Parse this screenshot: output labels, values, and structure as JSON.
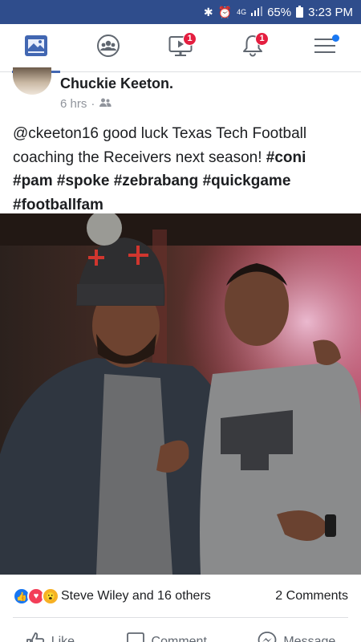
{
  "status_bar": {
    "battery": "65%",
    "time": "3:23 PM",
    "signal_label": "4G"
  },
  "nav": {
    "watch_badge": "1",
    "notifications_badge": "1"
  },
  "post": {
    "author": "Chuckie Keeton.",
    "time": "6 hrs",
    "text_plain": "@ckeeton16 good luck Texas Tech Football coaching the  Receivers next season! ",
    "tags": [
      "#coni",
      "#pam",
      "#spoke",
      "#zebrabang",
      "#quickgame",
      "#footballfam"
    ],
    "reactions_text": "Steve Wiley and 16 others",
    "comments_text": "2 Comments"
  },
  "actions": {
    "like": "Like",
    "comment": "Comment",
    "message": "Message"
  }
}
